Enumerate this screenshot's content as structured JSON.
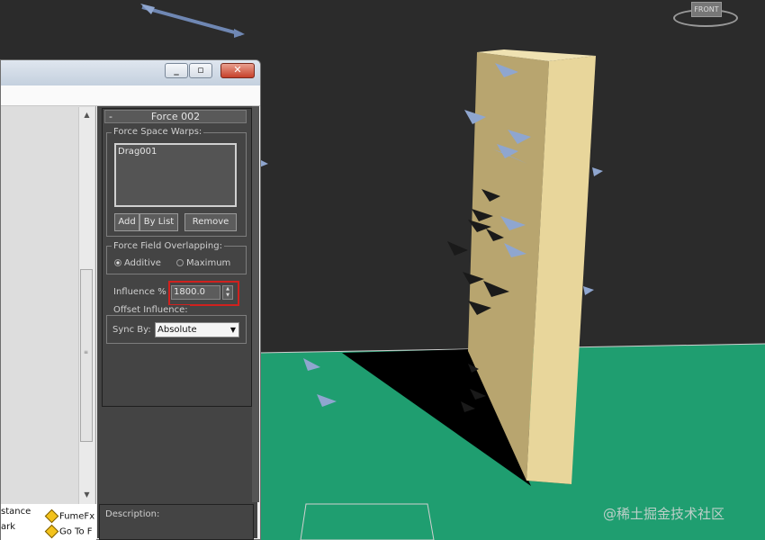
{
  "viewport": {
    "viewcube_label": "FRONT",
    "colors": {
      "background": "#2b2b2b",
      "ground": "#1f9e70",
      "board": "#d8c58a"
    },
    "watermark": "@稀土掘金技术社区"
  },
  "dialog": {
    "icons": [
      "minimize-icon",
      "maximize-icon",
      "close-icon"
    ],
    "bottom_items": [
      {
        "text": "stance"
      },
      {
        "text": "FumeFx"
      },
      {
        "text": "ark"
      },
      {
        "text": "Go To F"
      }
    ]
  },
  "rollout": {
    "title": "Force 002",
    "collapse": "-",
    "warps_group": "Force Space Warps:",
    "warps_list": [
      "Drag001"
    ],
    "buttons": {
      "add": "Add",
      "by_list": "By List",
      "remove": "Remove"
    },
    "overlap_group": "Force Field Overlapping:",
    "overlap_options": [
      "Additive",
      "Maximum"
    ],
    "overlap_selected": "Additive",
    "influence_label": "Influence %",
    "influence_value": "1800.0",
    "offset_group": "Offset Influence:",
    "syncby_label": "Sync By:",
    "syncby_value": "Absolute",
    "description_label": "Description:"
  }
}
